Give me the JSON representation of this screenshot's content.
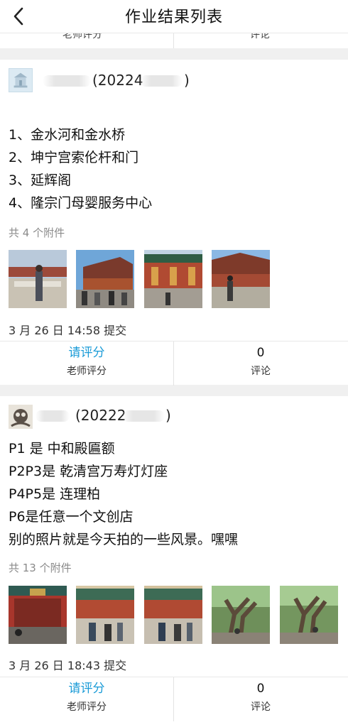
{
  "header": {
    "title": "作业结果列表"
  },
  "prev_card": {
    "rate_label": "老师评分",
    "comment_label": "评论"
  },
  "submissions": [
    {
      "student_id_prefix": "(20224",
      "student_id_suffix": ")",
      "content_lines": [
        "1、金水河和金水桥",
        "2、坤宁宫索伦杆和门",
        "3、延辉阁",
        "4、隆宗门母婴服务中心"
      ],
      "attachment_count": "共 4 个附件",
      "submitted_at": "3 月 26 日 14:58 提交",
      "rating_link": "请评分",
      "rating_label": "老师评分",
      "comment_count": "0",
      "comment_label": "评论"
    },
    {
      "student_id_prefix": "(20222",
      "student_id_suffix": ")",
      "content_lines": [
        "P1 是 中和殿匾额",
        "P2P3是 乾清宫万寿灯灯座",
        "P4P5是 连理柏",
        "P6是任意一个文创店",
        "别的照片就是今天拍的一些风景。嘿嘿"
      ],
      "attachment_count": "共 13 个附件",
      "submitted_at": "3 月 26 日 18:43 提交",
      "rating_link": "请评分",
      "rating_label": "老师评分",
      "comment_count": "0",
      "comment_label": "评论"
    }
  ],
  "icons": {
    "back": "chevron-left-icon"
  },
  "colors": {
    "link": "#1a9bd7",
    "page_bg": "#f0f0f0",
    "muted_text": "#8a8a8a"
  }
}
